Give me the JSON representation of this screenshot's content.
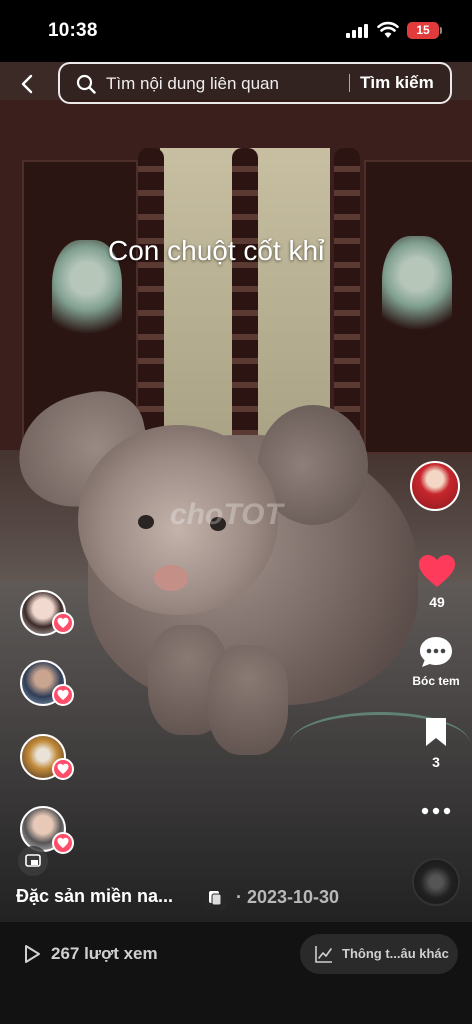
{
  "status_bar": {
    "time": "10:38",
    "battery": "15"
  },
  "search": {
    "placeholder": "Tìm nội dung liên quan",
    "button_label": "Tìm kiếm"
  },
  "post": {
    "overlay_title": "Con chuột cốt khỉ",
    "watermark": "choTOT",
    "caption": "Đặc sản miền na...",
    "date": "· 2023-10-30"
  },
  "actions": {
    "like_count": "49",
    "comment_label": "Bóc tem",
    "save_count": "3"
  },
  "bottom_bar": {
    "views": "267 lượt xem",
    "stats_label": "Thông t...âu khác"
  },
  "colors": {
    "like_red": "#ff3b5c",
    "battery_red": "#e23b3b",
    "heart_badge": "#ff4d6a"
  }
}
